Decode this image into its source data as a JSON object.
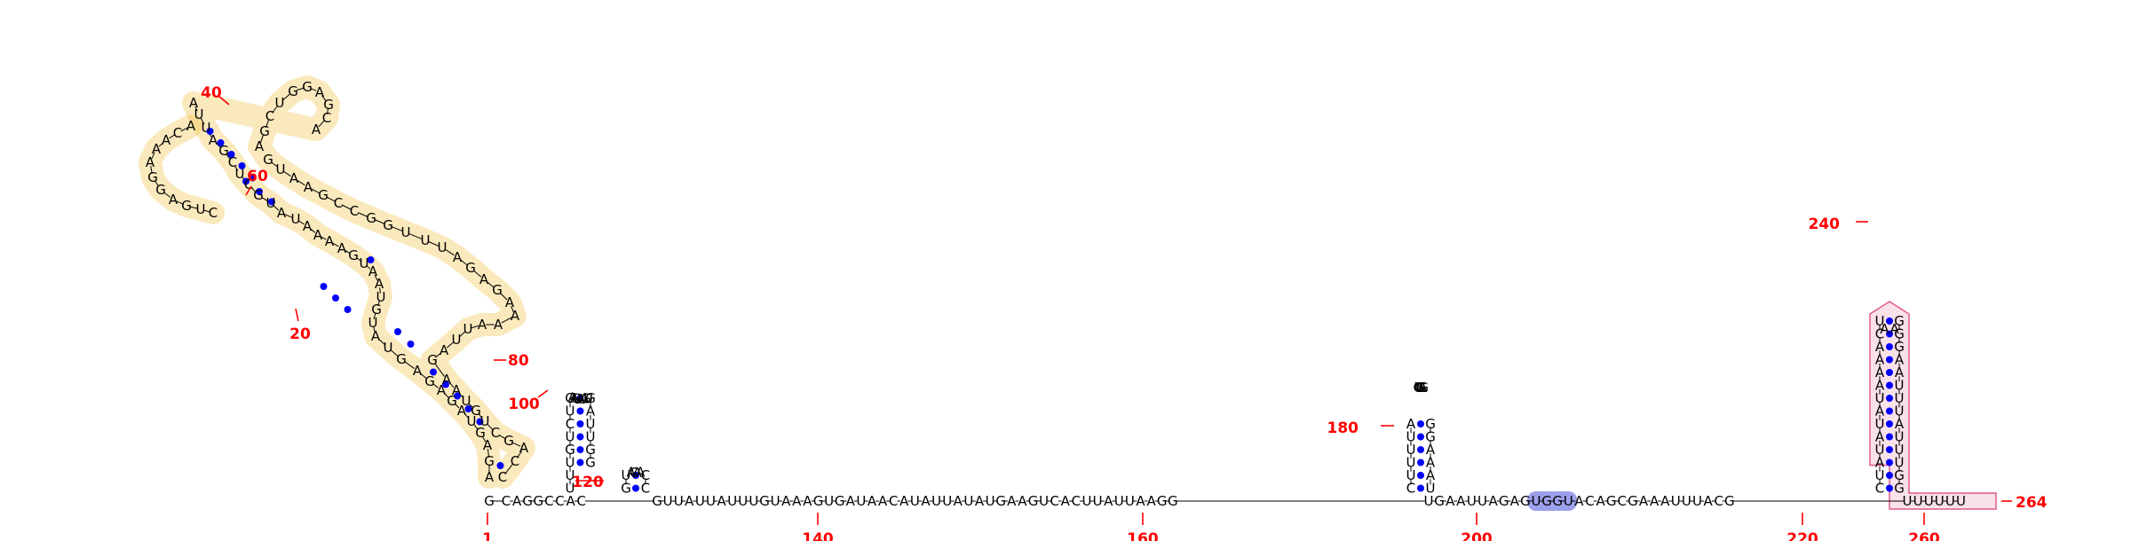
{
  "sequence_length": 264,
  "colors": {
    "nucleotide": "#000000",
    "base_pair": "#0000ff",
    "numbering": "#ff0000",
    "domain_yellow": "#f0c040",
    "domain_pink": "#e05a8a",
    "motif_blue": "#7b80e6"
  },
  "annotations": {
    "yellow_domain": "1-92",
    "pink_domain": "236-262",
    "blue_motif": "UGGU"
  },
  "position_labels": [
    "1",
    "20",
    "40",
    "60",
    "80",
    "100",
    "120",
    "140",
    "160",
    "180",
    "200",
    "220",
    "240",
    "260",
    "264"
  ],
  "backbone": {
    "seq_a": "G",
    "seq_b": "CAGGC",
    "seq_c": "CAC",
    "seq_d": "GUUAUUAUUUGUAAAGUGAUAACAUAUUAUAUGAAGUCACUUAUUAAGG",
    "seq_e": "UGAAUUAGAG",
    "seq_f": "UGGU",
    "seq_g": "ACAGCGAAAUUUACG",
    "seq_h": "UUUUUU"
  },
  "hairpins": {
    "h1_left": "UUUGUCUG",
    "h1_loop": "AAGUAUAGU",
    "h1_right": "GGUUAG",
    "h2_left": "GU",
    "h2_loop": "ACAA",
    "h2_right": "CC",
    "h3_left": "CUUUUA",
    "h3_loop": "CUGUGAG",
    "h3_right": "UAAAGG",
    "h4_left": "CUAUAUAUAAAACU",
    "h4_loop": "AA",
    "h4_right": "GGUUUAUUUAAGGG"
  },
  "yellow_arm": {
    "left_strand": "AGAGUAGAGAGUAUGUAAUGAAAAUAUGCUCGAUUA",
    "right_strand": "CCAGCUGUAAGAUUAAAAGAGAUUUGGCCGAAUG",
    "loops": "AGAGCAUCAAAGGAGCUAAUG"
  }
}
